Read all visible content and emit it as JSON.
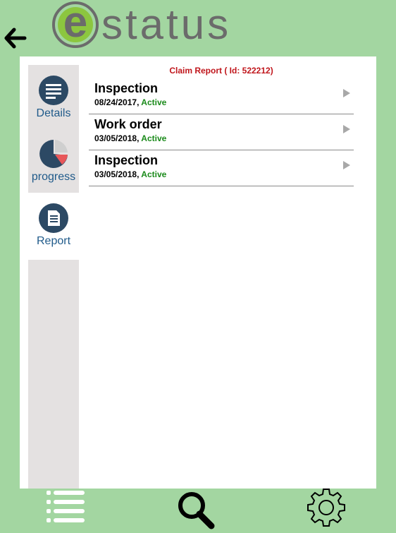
{
  "app": {
    "logo_letter": "e",
    "logo_text": "status",
    "colors": {
      "background": "#a3d6a1",
      "accent_green": "#8cc63f",
      "title_red": "#c0161c",
      "status_green": "#1a8a1a",
      "nav_blue": "#1f5a8a"
    }
  },
  "header": {
    "back_icon": "arrow-left-icon"
  },
  "sidebar": {
    "items": [
      {
        "label": "Details",
        "icon": "list-lines-icon"
      },
      {
        "label": "progress",
        "icon": "pie-chart-icon"
      },
      {
        "label": "Report",
        "icon": "document-icon"
      }
    ]
  },
  "report": {
    "title": "Claim Report ( Id: 522212)",
    "items": [
      {
        "title": "Inspection",
        "date": "08/24/2017",
        "separator": ", ",
        "status": "Active"
      },
      {
        "title": "Work order",
        "date": "03/05/2018",
        "separator": ", ",
        "status": "Active"
      },
      {
        "title": "Inspection",
        "date": "03/05/2018",
        "separator": ", ",
        "status": "Active"
      }
    ]
  },
  "bottombar": {
    "icons": [
      "list-icon",
      "search-icon",
      "gear-icon"
    ]
  }
}
